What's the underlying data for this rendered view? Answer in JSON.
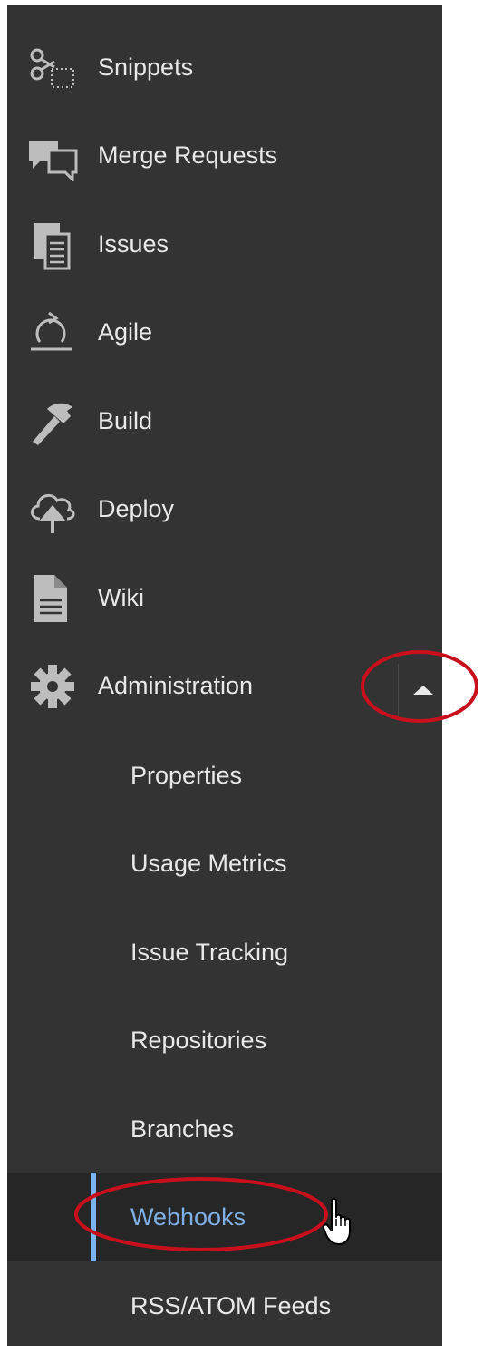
{
  "sidebar": {
    "items": [
      {
        "label": "Snippets",
        "icon": "scissors-icon"
      },
      {
        "label": "Merge Requests",
        "icon": "chat-bubbles-icon"
      },
      {
        "label": "Issues",
        "icon": "clipboard-icon"
      },
      {
        "label": "Agile",
        "icon": "cycle-icon"
      },
      {
        "label": "Build",
        "icon": "hammer-icon"
      },
      {
        "label": "Deploy",
        "icon": "cloud-upload-icon"
      },
      {
        "label": "Wiki",
        "icon": "document-icon"
      },
      {
        "label": "Administration",
        "icon": "gear-icon",
        "expanded": true
      }
    ],
    "admin_subitems": [
      {
        "label": "Properties"
      },
      {
        "label": "Usage Metrics"
      },
      {
        "label": "Issue Tracking"
      },
      {
        "label": "Repositories"
      },
      {
        "label": "Branches"
      },
      {
        "label": "Webhooks",
        "active": true
      },
      {
        "label": "RSS/ATOM Feeds"
      }
    ],
    "collapse_toggle_icon": "caret-up-icon"
  },
  "colors": {
    "sidebar_bg": "#333333",
    "text": "#e9e9e9",
    "active_text": "#7fb0e6",
    "active_bar": "#7ab3ee",
    "annotation": "#c8101c"
  }
}
